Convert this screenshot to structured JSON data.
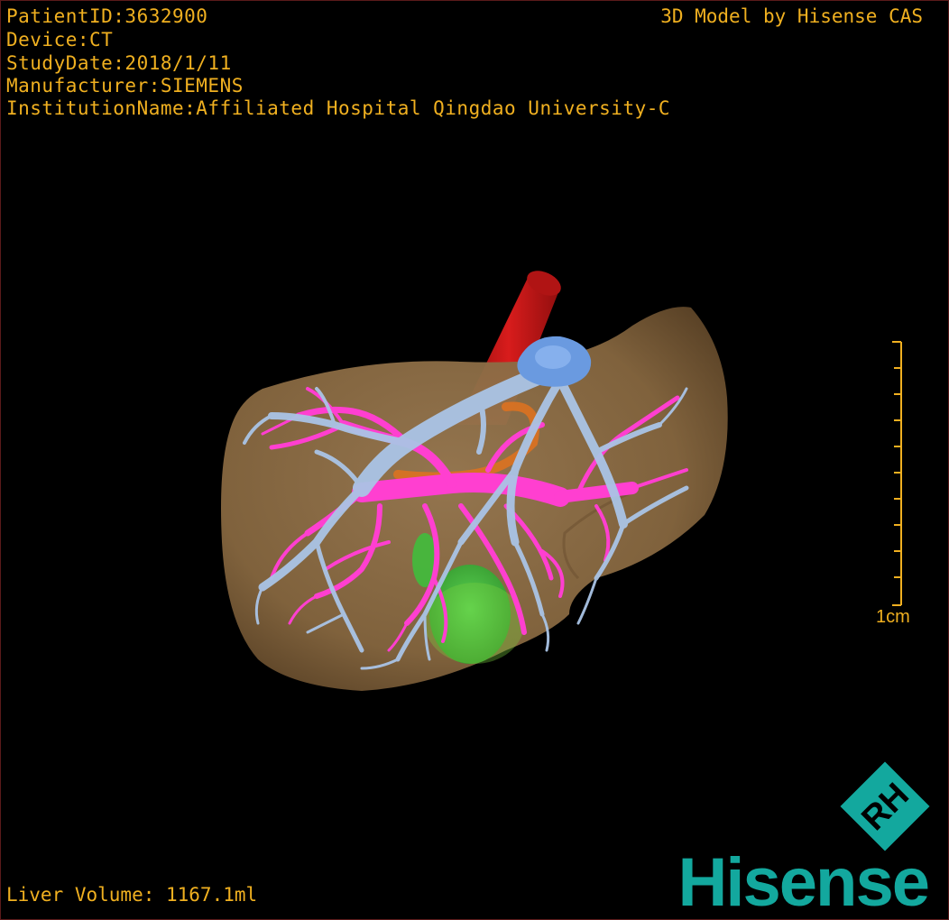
{
  "patient_info": {
    "patient_id": "PatientID:3632900",
    "device": "Device:CT",
    "study_date": "StudyDate:2018/1/11",
    "manufacturer": "Manufacturer:SIEMENS",
    "institution": "InstitutionName:Affiliated Hospital Qingdao University-C"
  },
  "model_credit": "3D Model by Hisense CAS",
  "liver_volume": "Liver Volume: 1167.1ml",
  "scale_label": "1cm",
  "logo": {
    "badge_text": "RH",
    "brand_text": "Hisense"
  },
  "colors": {
    "overlay_text": "#f0b020",
    "liver": "#8a6a45",
    "hepatic_vein": "#aac4e6",
    "portal_vein": "#ff3fd0",
    "ivc": "#c81818",
    "gallbladder": "#3cc23c",
    "brand": "#13a89e"
  }
}
